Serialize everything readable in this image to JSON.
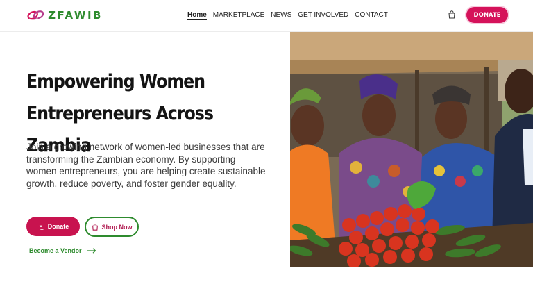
{
  "brand": {
    "name": "ZFAWIB",
    "logo_icon": "linked-rings-logo"
  },
  "nav": {
    "items": [
      {
        "label": "Home",
        "active": true
      },
      {
        "label": "MARKETPLACE",
        "active": false
      },
      {
        "label": "NEWS",
        "active": false
      },
      {
        "label": "GET INVOLVED",
        "active": false
      },
      {
        "label": "CONTACT",
        "active": false
      }
    ],
    "cart_icon": "shopping-bag-icon",
    "donate_label": "DONATE"
  },
  "hero": {
    "title_line1": "Empowering Women",
    "title_line2": "Entrepreneurs Across Zambia",
    "description": "Join a growing network of women-led businesses that are transforming the Zambian economy. By supporting women entrepreneurs, you are helping create sustainable growth, reduce poverty, and foster gender equality.",
    "donate_label": "Donate",
    "donate_icon": "hand-heart-icon",
    "shop_label": "Shop Now",
    "shop_icon": "shopping-bag-icon",
    "vendor_label": "Become a Vendor",
    "vendor_icon": "arrow-right-icon",
    "image": "women vendors at a market stall with tomatoes and cucumbers"
  },
  "colors": {
    "primary": "#d5125a",
    "accent_green": "#2e8b2e",
    "text_dark": "#141414"
  }
}
